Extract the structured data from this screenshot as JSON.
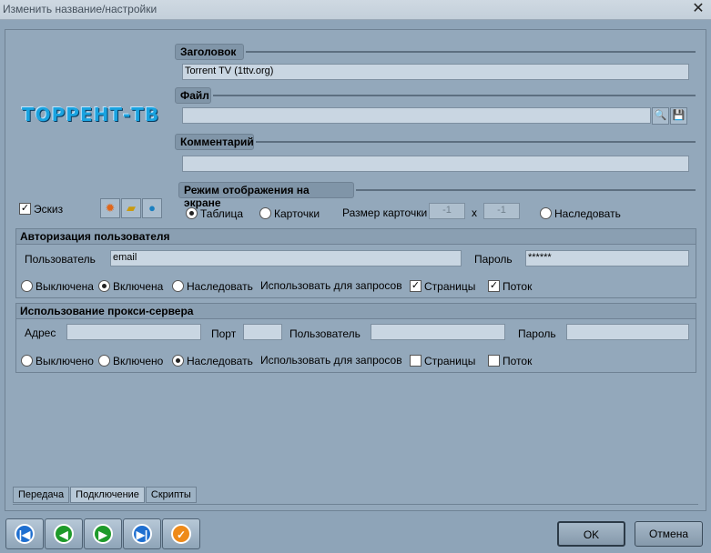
{
  "window": {
    "title": "Изменить название/настройки",
    "close_icon": "close-icon"
  },
  "logo": {
    "text": "ТОРРЕНТ-ТВ"
  },
  "sections": {
    "title_label": "Заголовок",
    "title_value": "Torrent TV (1ttv.org)",
    "file_label": "Файл",
    "file_value": "",
    "comment_label": "Комментарий",
    "comment_value": "",
    "display_mode_label": "Режим отображения на экране"
  },
  "sketch": {
    "label": "Эскиз",
    "checked": true
  },
  "display_mode": {
    "table": "Таблица",
    "cards": "Карточки",
    "card_size_label": "Размер карточки",
    "size_w": "-1",
    "x_label": "x",
    "size_h": "-1",
    "inherit": "Наследовать",
    "selected": "table"
  },
  "auth": {
    "title": "Авторизация пользователя",
    "user_label": "Пользователь",
    "user_value": "email",
    "password_label": "Пароль",
    "password_value": "******",
    "off": "Выключена",
    "on": "Включена",
    "inherit": "Наследовать",
    "use_for": "Использовать для запросов",
    "pages": "Страницы",
    "stream": "Поток",
    "selected": "on",
    "pages_checked": true,
    "stream_checked": true
  },
  "proxy": {
    "title": "Использование прокси-сервера",
    "address_label": "Адрес",
    "port_label": "Порт",
    "user_label": "Пользователь",
    "password_label": "Пароль",
    "off": "Выключено",
    "on": "Включено",
    "inherit": "Наследовать",
    "use_for": "Использовать для запросов",
    "pages": "Страницы",
    "stream": "Поток",
    "selected": "inherit",
    "pages_checked": false,
    "stream_checked": false
  },
  "tabs": [
    "Передача",
    "Подключение",
    "Скрипты"
  ],
  "active_tab": "Подключение",
  "nav_buttons": [
    {
      "name": "first-icon",
      "glyph": "|◀",
      "color": "#1f6fd0"
    },
    {
      "name": "prev-icon",
      "glyph": "◀",
      "color": "#1e9a2a"
    },
    {
      "name": "next-icon",
      "glyph": "▶",
      "color": "#1e9a2a"
    },
    {
      "name": "last-icon",
      "glyph": "▶|",
      "color": "#1f6fd0"
    },
    {
      "name": "apply-icon",
      "glyph": "✓",
      "color": "#ee8a1a"
    }
  ],
  "buttons": {
    "ok": "OK",
    "cancel": "Отмена"
  }
}
